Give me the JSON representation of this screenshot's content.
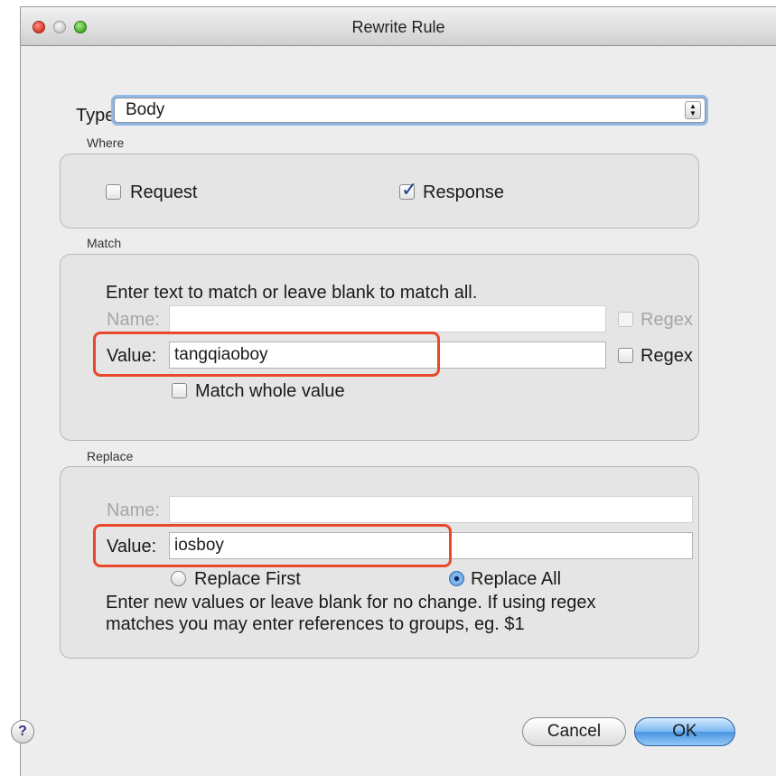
{
  "window": {
    "title": "Rewrite Rule"
  },
  "type_row": {
    "label": "Type:",
    "value": "Body"
  },
  "where": {
    "section_label": "Where",
    "request_label": "Request",
    "request_checked": false,
    "response_label": "Response",
    "response_checked": true
  },
  "match": {
    "section_label": "Match",
    "instruction": "Enter text to match or leave blank to match all.",
    "name_label": "Name:",
    "name_value": "",
    "name_regex_label": "Regex",
    "value_label": "Value:",
    "value_value": "tangqiaoboy",
    "value_regex_label": "Regex",
    "match_whole_label": "Match whole value"
  },
  "replace": {
    "section_label": "Replace",
    "name_label": "Name:",
    "name_value": "",
    "value_label": "Value:",
    "value_value": "iosboy",
    "replace_first_label": "Replace First",
    "replace_all_label": "Replace All",
    "selected_option": "Replace All",
    "hint_line1": "Enter new values or leave blank for no change. If using regex",
    "hint_line2": "matches you may enter references to groups, eg. $1"
  },
  "footer": {
    "help_label": "?",
    "cancel_label": "Cancel",
    "ok_label": "OK"
  },
  "colors": {
    "highlight": "#e8492a",
    "accent": "#4b95e2",
    "checkmark": "#1c3f8f"
  }
}
